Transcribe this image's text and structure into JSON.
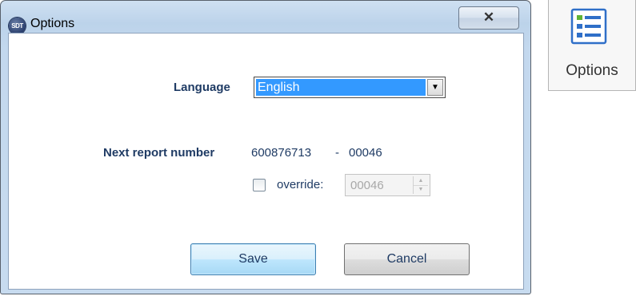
{
  "dialog": {
    "title": "Options",
    "logo_text": "SDT",
    "close_glyph": "✕"
  },
  "form": {
    "language_label": "Language",
    "language_value": "English",
    "next_report_label": "Next report number",
    "report_number": "600876713",
    "report_separator": "-",
    "report_suffix": "00046",
    "override_label": "override:",
    "override_checked": false,
    "override_value": "00046"
  },
  "buttons": {
    "save": "Save",
    "cancel": "Cancel"
  },
  "ribbon": {
    "options_label": "Options",
    "icon": "list-icon"
  },
  "colors": {
    "label_text": "#1f3b64",
    "selection": "#3399ff",
    "icon_green": "#5fb336",
    "icon_blue": "#2f6fc8"
  }
}
